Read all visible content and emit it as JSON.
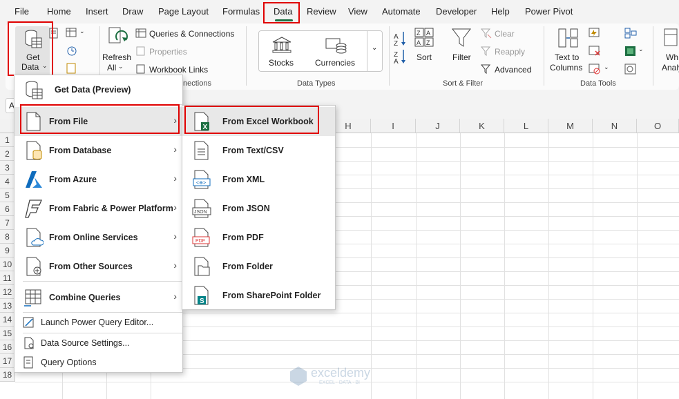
{
  "menubar": {
    "tabs": [
      "File",
      "Home",
      "Insert",
      "Draw",
      "Page Layout",
      "Formulas",
      "Data",
      "Review",
      "View",
      "Automate",
      "Developer",
      "Help",
      "Power Pivot"
    ],
    "active_tab": "Data"
  },
  "ribbon": {
    "get_data_line1": "Get",
    "get_data_line2": "Data",
    "refresh_line1": "Refresh",
    "refresh_line2": "All",
    "queries_connections": "Queries & Connections",
    "properties": "Properties",
    "workbook_links": "Workbook Links",
    "connections_group_tail": "nections",
    "stocks": "Stocks",
    "currencies": "Currencies",
    "data_types_group": "Data Types",
    "sort": "Sort",
    "filter": "Filter",
    "clear": "Clear",
    "reapply": "Reapply",
    "advanced": "Advanced",
    "sort_filter_group": "Sort & Filter",
    "text_to_columns_line1": "Text to",
    "text_to_columns_line2": "Columns",
    "data_tools_group": "Data Tools",
    "whatif_line1": "Wh",
    "whatif_line2": "Analy"
  },
  "formula_bar": {
    "name_box": "A"
  },
  "grid": {
    "columns": [
      "H",
      "I",
      "J",
      "K",
      "L",
      "M",
      "N",
      "O"
    ],
    "rows": [
      "1",
      "2",
      "3",
      "4",
      "5",
      "6",
      "7",
      "8",
      "9",
      "10",
      "11",
      "12",
      "13",
      "14",
      "15",
      "16",
      "17",
      "18"
    ]
  },
  "get_data_menu": {
    "get_data_preview": "Get Data (Preview)",
    "from_file": "From File",
    "from_database": "From Database",
    "from_azure": "From Azure",
    "from_fabric": "From Fabric & Power Platform",
    "from_online": "From Online Services",
    "from_other": "From Other Sources",
    "combine_queries": "Combine Queries",
    "launch_pq": "Launch Power Query Editor...",
    "data_source_settings": "Data Source Settings...",
    "query_options": "Query Options"
  },
  "from_file_submenu": {
    "excel_workbook": "From Excel Workbook",
    "text_csv": "From Text/CSV",
    "xml": "From XML",
    "json": "From JSON",
    "pdf": "From PDF",
    "folder": "From Folder",
    "sharepoint_folder": "From SharePoint Folder"
  },
  "watermark": {
    "brand": "exceldemy",
    "tagline": "EXCEL · DATA · BI"
  },
  "colors": {
    "highlight_red": "#e00000",
    "excel_green": "#1d6f42",
    "azure_blue": "#0f6cbd"
  }
}
